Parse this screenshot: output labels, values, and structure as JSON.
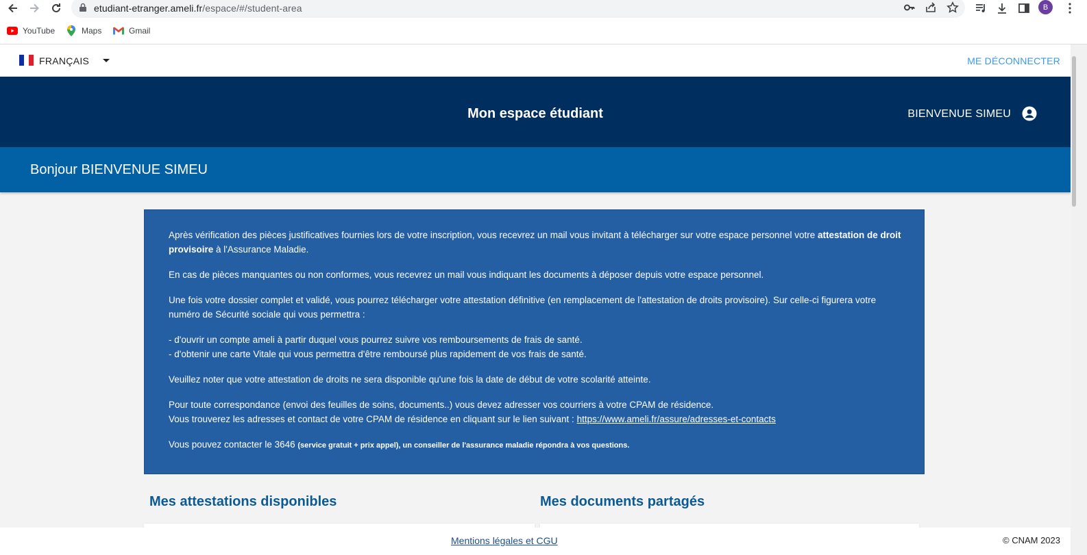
{
  "browser": {
    "url_host": "etudiant-etranger.ameli.fr",
    "url_path": "/espace/#/student-area",
    "profile_initial": "B",
    "bookmarks": [
      {
        "label": "YouTube",
        "icon": "youtube-icon"
      },
      {
        "label": "Maps",
        "icon": "maps-icon"
      },
      {
        "label": "Gmail",
        "icon": "gmail-icon"
      }
    ]
  },
  "topbar": {
    "language": "FRANÇAIS",
    "logout": "ME DÉCONNECTER"
  },
  "header": {
    "title": "Mon espace étudiant",
    "user_name": "BIENVENUE SIMEU"
  },
  "greeting": "Bonjour BIENVENUE SIMEU",
  "info": {
    "p1_start": "Après vérification des pièces justificatives fournies lors de votre inscription, vous recevrez un mail vous invitant à télécharger sur votre espace personnel votre ",
    "p1_bold": "attestation de droit provisoire",
    "p1_end": " à l'Assurance Maladie.",
    "p2": "En cas de pièces manquantes ou non conformes, vous recevrez un mail vous indiquant les documents à déposer depuis votre espace personnel.",
    "p3": "Une fois votre dossier complet et validé, vous pourrez télécharger votre attestation définitive (en remplacement de l'attestation de droits provisoire). Sur celle-ci figurera votre numéro de Sécurité sociale qui vous permettra :",
    "p4_line1": "- d'ouvrir un compte ameli à partir duquel vous pourrez suivre vos remboursements de frais de santé.",
    "p4_line2": "- d'obtenir une carte Vitale qui vous permettra d'être remboursé plus rapidement de vos frais de santé.",
    "p5": "Veuillez noter que votre attestation de droits ne sera disponible qu'une fois la date de début de votre scolarité atteinte.",
    "p6_line1": "Pour toute correspondance (envoi des feuilles de soins, documents..) vous devez adresser vos courriers à votre CPAM de résidence.",
    "p6_line2": "Vous trouverez les adresses et contact de votre CPAM de résidence en cliquant sur le lien suivant : ",
    "p6_link": "https://www.ameli.fr/assure/adresses-et-contacts",
    "p7_start": "Vous pouvez contacter le 3646 ",
    "p7_small": "(service gratuit + prix appel), un conseiller de l'assurance maladie répondra à vos questions."
  },
  "sections": {
    "attestations": "Mes attestations disponibles",
    "documents": "Mes documents partagés"
  },
  "footer": {
    "legal": "Mentions légales et CGU",
    "copyright": "© CNAM 2023"
  },
  "colors": {
    "header_dark": "#002f5f",
    "header_blue": "#0260a4",
    "info_box": "#245ea3",
    "section_title": "#0b5a94",
    "logout_link": "#3b9be0"
  }
}
